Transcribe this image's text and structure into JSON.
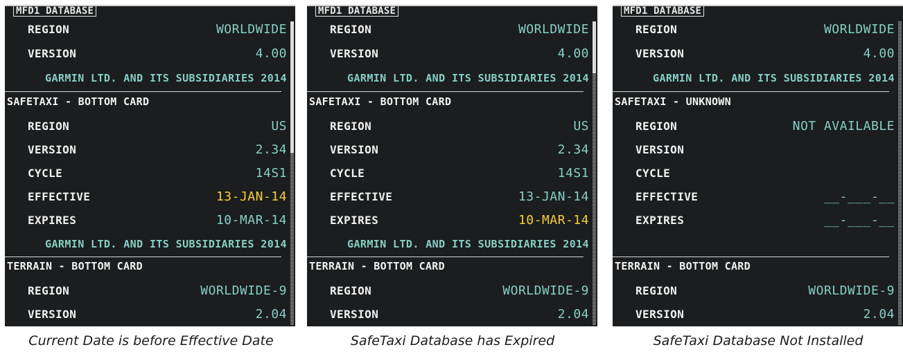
{
  "panels": [
    {
      "title": "MFD1 DATABASE",
      "mfd1_region_label": "REGION",
      "mfd1_region": "WORLDWIDE",
      "mfd1_version_label": "VERSION",
      "mfd1_version": "4.00",
      "mfd1_copyright": "GARMIN LTD. AND ITS SUBSIDIARIES 2014",
      "safetaxi_header": "SAFETAXI - BOTTOM CARD",
      "st_region_label": "REGION",
      "st_region": "US",
      "st_version_label": "VERSION",
      "st_version": "2.34",
      "st_cycle_label": "CYCLE",
      "st_cycle": "14S1",
      "st_effective_label": "EFFECTIVE",
      "st_effective": "13-JAN-14",
      "st_expires_label": "EXPIRES",
      "st_expires": "10-MAR-14",
      "st_copyright": "GARMIN LTD. AND ITS SUBSIDIARIES 2014",
      "terrain_header": "TERRAIN - BOTTOM CARD",
      "tr_region_label": "REGION",
      "tr_region": "WORLDWIDE-9",
      "tr_version_label": "VERSION",
      "tr_version": "2.04",
      "highlighted_field": "effective",
      "caption": "Current Date is before Effective Date"
    },
    {
      "title": "MFD1 DATABASE",
      "mfd1_region_label": "REGION",
      "mfd1_region": "WORLDWIDE",
      "mfd1_version_label": "VERSION",
      "mfd1_version": "4.00",
      "mfd1_copyright": "GARMIN LTD. AND ITS SUBSIDIARIES 2014",
      "safetaxi_header": "SAFETAXI - BOTTOM CARD",
      "st_region_label": "REGION",
      "st_region": "US",
      "st_version_label": "VERSION",
      "st_version": "2.34",
      "st_cycle_label": "CYCLE",
      "st_cycle": "14S1",
      "st_effective_label": "EFFECTIVE",
      "st_effective": "13-JAN-14",
      "st_expires_label": "EXPIRES",
      "st_expires": "10-MAR-14",
      "st_copyright": "GARMIN LTD. AND ITS SUBSIDIARIES 2014",
      "terrain_header": "TERRAIN - BOTTOM CARD",
      "tr_region_label": "REGION",
      "tr_region": "WORLDWIDE-9",
      "tr_version_label": "VERSION",
      "tr_version": "2.04",
      "highlighted_field": "expires",
      "caption": "SafeTaxi Database has Expired"
    },
    {
      "title": "MFD1 DATABASE",
      "mfd1_region_label": "REGION",
      "mfd1_region": "WORLDWIDE",
      "mfd1_version_label": "VERSION",
      "mfd1_version": "4.00",
      "mfd1_copyright": "GARMIN LTD. AND ITS SUBSIDIARIES 2014",
      "safetaxi_header": "SAFETAXI - UNKNOWN",
      "st_region_label": "REGION",
      "st_region": "NOT AVAILABLE",
      "st_version_label": "VERSION",
      "st_version": "",
      "st_cycle_label": "CYCLE",
      "st_cycle": "",
      "st_effective_label": "EFFECTIVE",
      "st_effective": "__-___-__",
      "st_expires_label": "EXPIRES",
      "st_expires": "__-___-__",
      "st_copyright": "",
      "terrain_header": "TERRAIN - BOTTOM CARD",
      "tr_region_label": "REGION",
      "tr_region": "WORLDWIDE-9",
      "tr_version_label": "VERSION",
      "tr_version": "2.04",
      "highlighted_field": "",
      "caption": "SafeTaxi Database Not Installed"
    }
  ],
  "colors": {
    "background": "#1b1d1e",
    "label": "#f2f2f2",
    "value": "#86cfc7",
    "warning": "#f7cf3a"
  }
}
